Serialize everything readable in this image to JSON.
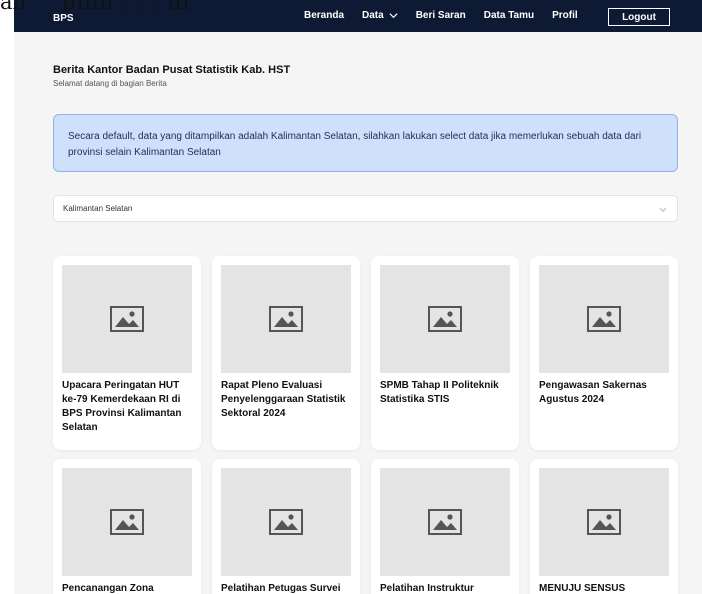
{
  "overlay": {
    "fragment_1": "an",
    "fragment_2": "pilih . . . di"
  },
  "navbar": {
    "brand": "BPS",
    "links": [
      {
        "label": "Beranda"
      },
      {
        "label": "Data",
        "has_dropdown": true
      },
      {
        "label": "Beri Saran"
      },
      {
        "label": "Data Tamu"
      },
      {
        "label": "Profil"
      }
    ],
    "logout_label": "Logout",
    "background": "#0e1a33"
  },
  "header": {
    "title": "Berita Kantor Badan Pusat Statistik Kab. HST",
    "subtitle": "Selamat datang di bagian Berita"
  },
  "alert": {
    "text": "Secara default, data yang ditampilkan adalah Kalimantan Selatan, silahkan lakukan select data jika memerlukan sebuah data dari provinsi selain Kalimantan Selatan",
    "background": "#cfe0fb"
  },
  "province_select": {
    "selected": "Kalimantan Selatan"
  },
  "news_cards": [
    {
      "title": "Upacara Peringatan HUT ke-79 Kemerdekaan RI di BPS Provinsi Kalimantan Selatan",
      "icon": "image-placeholder-icon"
    },
    {
      "title": "Rapat Pleno Evaluasi Penyelenggaraan Statistik Sektoral 2024",
      "icon": "image-placeholder-icon"
    },
    {
      "title": "SPMB Tahap II Politeknik Statistika STIS",
      "icon": "image-placeholder-icon"
    },
    {
      "title": "Pengawasan Sakernas Agustus 2024",
      "icon": "image-placeholder-icon"
    },
    {
      "title": "Pencanangan Zona",
      "icon": "image-placeholder-icon"
    },
    {
      "title": "Pelatihan Petugas Survei",
      "icon": "image-placeholder-icon"
    },
    {
      "title": "Pelatihan Instruktur",
      "icon": "image-placeholder-icon"
    },
    {
      "title": "MENUJU SENSUS",
      "icon": "image-placeholder-icon"
    }
  ]
}
